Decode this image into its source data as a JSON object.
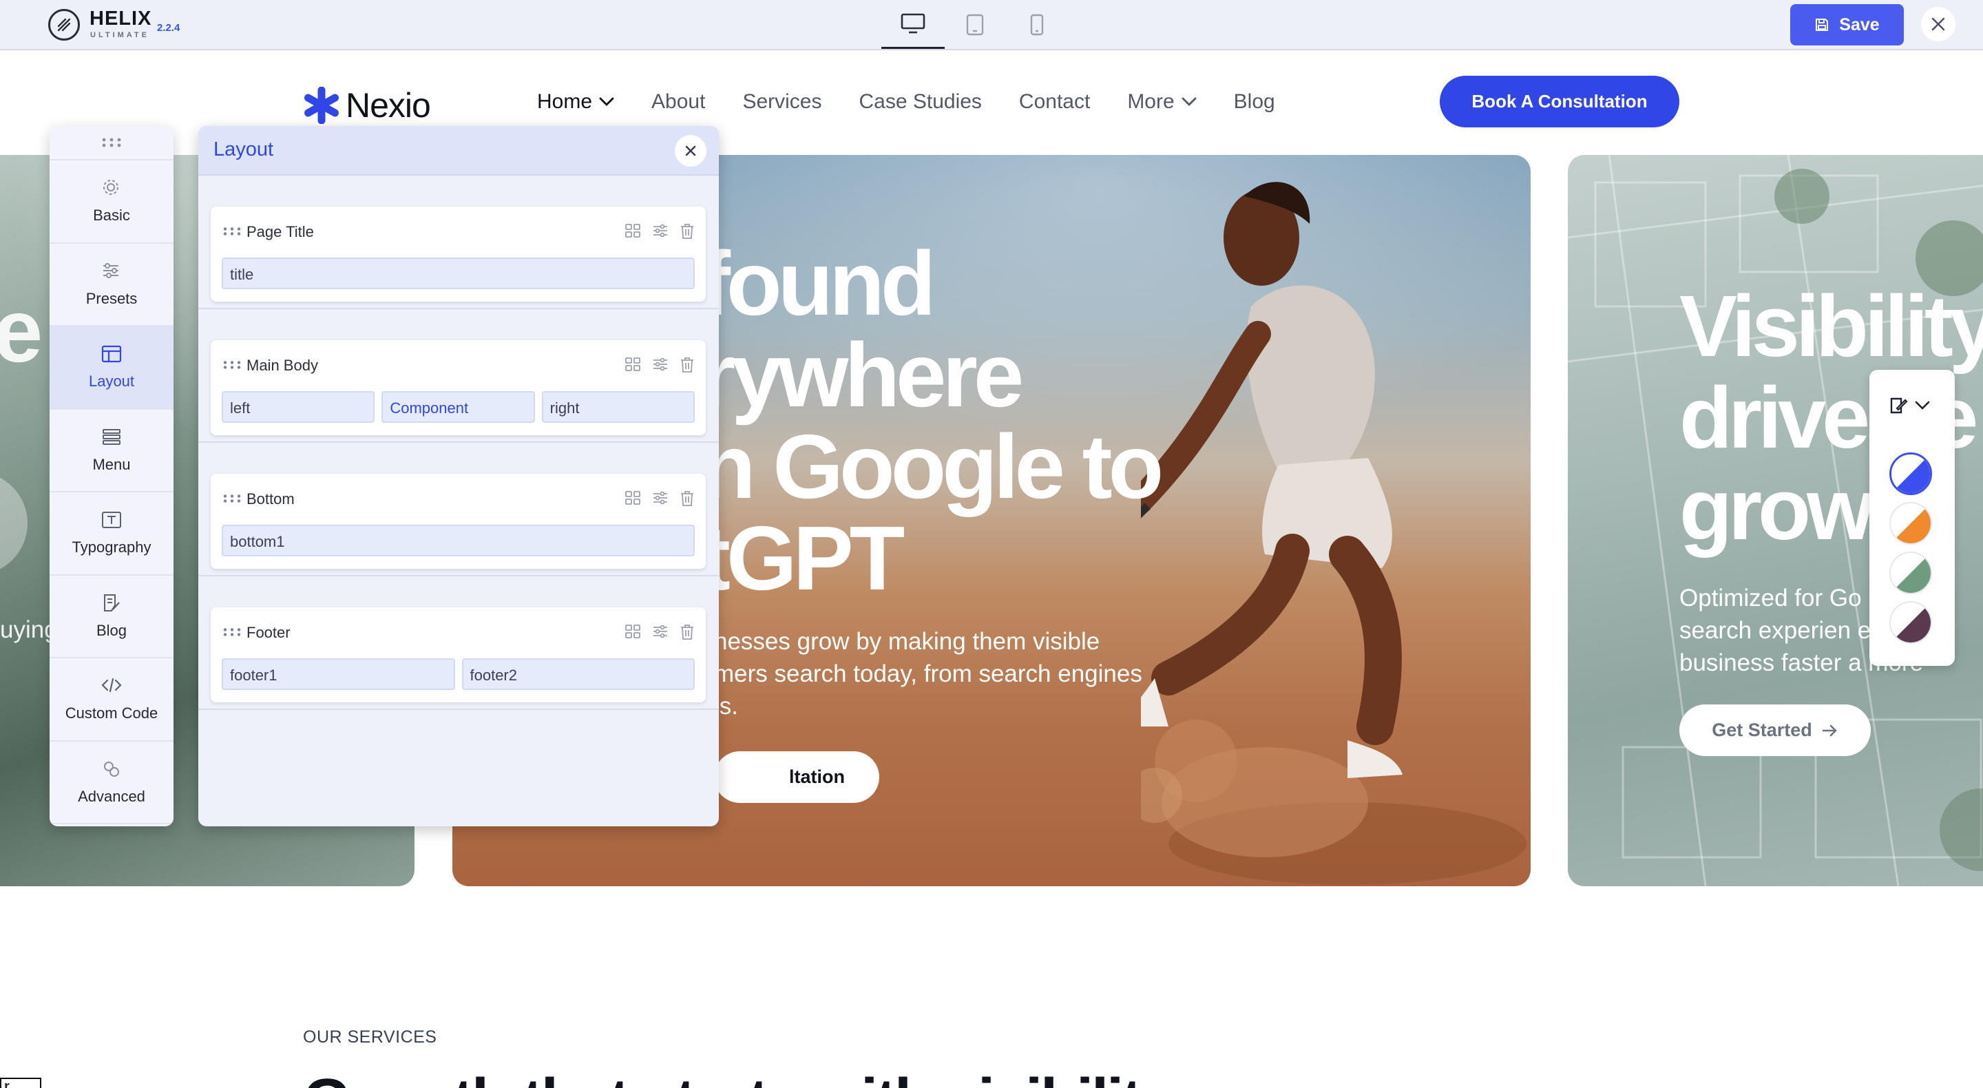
{
  "topbar": {
    "brand": "HELIX",
    "brand_sub": "ULTIMATE",
    "version": "2.2.4",
    "devices": [
      "desktop-icon",
      "tablet-icon",
      "mobile-icon"
    ],
    "save_label": "Save",
    "accent": "#4a5cf0"
  },
  "site": {
    "logo_text": "Nexio",
    "nav": [
      {
        "label": "Home",
        "dropdown": true,
        "active": true
      },
      {
        "label": "About"
      },
      {
        "label": "Services"
      },
      {
        "label": "Case Studies"
      },
      {
        "label": "Contact"
      },
      {
        "label": "More",
        "dropdown": true
      },
      {
        "label": "Blog"
      }
    ],
    "cta_label": "Book A Consultation",
    "brand_color": "#3046e6"
  },
  "hero": {
    "left_fragments": {
      "big": "e",
      "small": "uying"
    },
    "main": {
      "title_lines": [
        "found",
        "rywhere",
        "n Google to",
        "tGPT"
      ],
      "subtitle_lines": [
        "nesses grow by making them visible",
        "mers search today, from search engines",
        "ls."
      ],
      "button": "ltation"
    },
    "right": {
      "title_lines": [
        "Visibility",
        "drives e",
        "grow"
      ],
      "subtitle_lines": [
        "Optimized for Go          l p",
        "search experien         e h",
        "business faster a      more"
      ],
      "button": "Get Started"
    }
  },
  "palette": {
    "swatches": [
      {
        "name": "blue",
        "c1": "#ffffff",
        "c2": "#3b4ff0",
        "selected": true
      },
      {
        "name": "orange",
        "c1": "#ffffff",
        "c2": "#ef8a2e"
      },
      {
        "name": "green",
        "c1": "#ffffff",
        "c2": "#6f9c7e"
      },
      {
        "name": "plum",
        "c1": "#ffffff",
        "c2": "#5b3a4f"
      }
    ]
  },
  "sections": {
    "services_label": "OUR SERVICES",
    "growth_heading": "Growth that starts with visibility",
    "corner_fragment": "r"
  },
  "sidebar": {
    "items": [
      {
        "label": "Basic",
        "icon": "gear-icon"
      },
      {
        "label": "Presets",
        "icon": "sliders-icon"
      },
      {
        "label": "Layout",
        "icon": "layout-icon",
        "active": true
      },
      {
        "label": "Menu",
        "icon": "menu-icon"
      },
      {
        "label": "Typography",
        "icon": "typography-icon"
      },
      {
        "label": "Blog",
        "icon": "blog-icon"
      },
      {
        "label": "Custom Code",
        "icon": "code-icon"
      },
      {
        "label": "Advanced",
        "icon": "advanced-icon"
      }
    ]
  },
  "layout_panel": {
    "title": "Layout",
    "rows": [
      {
        "name": "Page Title",
        "columns": [
          "title"
        ]
      },
      {
        "name": "Main Body",
        "columns": [
          "left",
          "Component",
          "right"
        ]
      },
      {
        "name": "Bottom",
        "columns": [
          "bottom1"
        ]
      },
      {
        "name": "Footer",
        "columns": [
          "footer1",
          "footer2"
        ]
      }
    ]
  }
}
